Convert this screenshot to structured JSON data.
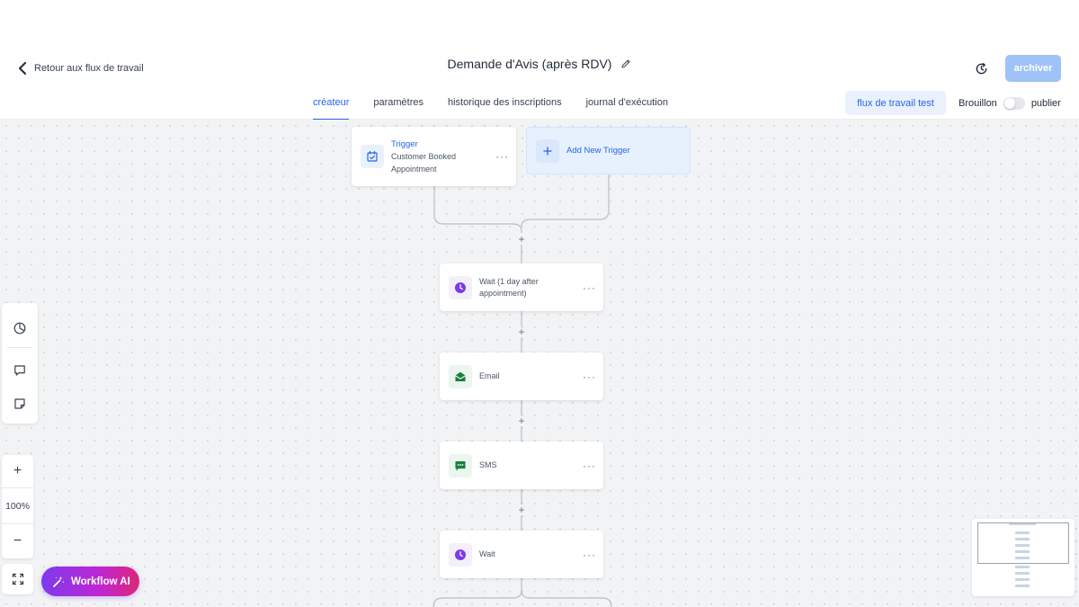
{
  "header": {
    "back_label": "Retour aux flux de travail",
    "title": "Demande d'Avis (après RDV)",
    "archive_label": "archiver",
    "tabs": [
      {
        "label": "créateur",
        "active": true
      },
      {
        "label": "paramètres",
        "active": false
      },
      {
        "label": "historique des inscriptions",
        "active": false
      },
      {
        "label": "journal d'exécution",
        "active": false
      }
    ],
    "test_label": "flux de travail test",
    "status_draft": "Brouillon",
    "status_publish": "publier",
    "publish_toggle_on": false
  },
  "canvas": {
    "trigger": {
      "title": "Trigger",
      "subtitle": "Customer Booked Appointment",
      "icon": "calendar-check-icon"
    },
    "add_trigger_label": "Add New Trigger",
    "actions": [
      {
        "label": "Wait (1 day after appointment)",
        "icon": "clock-icon",
        "color": "#7c3aed"
      },
      {
        "label": "Email",
        "icon": "email-icon",
        "color": "#15803d"
      },
      {
        "label": "SMS",
        "icon": "chat-icon",
        "color": "#15803d"
      },
      {
        "label": "Wait",
        "icon": "clock-icon",
        "color": "#7c3aed"
      }
    ],
    "more_glyph": "···",
    "plus_glyph": "+"
  },
  "toolbar": {
    "zoom_level": "100%",
    "zoom_in": "+",
    "zoom_out": "−",
    "ai_label": "Workflow AI"
  },
  "colors": {
    "accent": "#2563eb",
    "archive_button": "#9fc2f7",
    "wait_icon": "#7c3aed",
    "message_icon": "#15803d"
  }
}
